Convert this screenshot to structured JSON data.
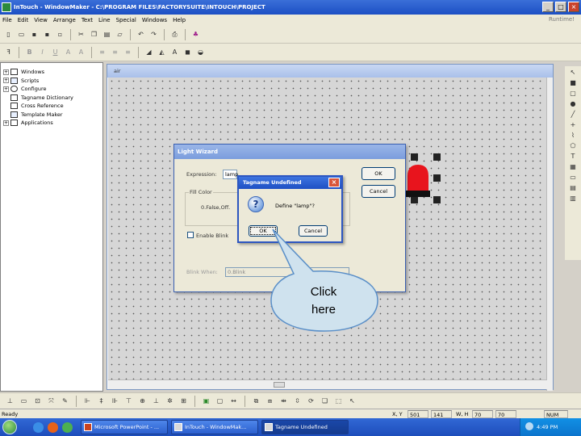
{
  "window": {
    "title": "InTouch - WindowMaker - C:\\PROGRAM FILES\\FACTORYSUITE\\INTOUCH\\PROJECT",
    "minimize_glyph": "_",
    "maximize_glyph": "□",
    "close_glyph": "×"
  },
  "menu": {
    "items": [
      "File",
      "Edit",
      "View",
      "Arrange",
      "Text",
      "Line",
      "Special",
      "Windows",
      "Help"
    ],
    "runtime_label": "Runtime!"
  },
  "tree": {
    "items": [
      {
        "label": "Windows",
        "expander": "+"
      },
      {
        "label": "Scripts",
        "expander": "+"
      },
      {
        "label": "Configure",
        "expander": "+"
      },
      {
        "label": "Tagname Dictionary",
        "expander": ""
      },
      {
        "label": "Cross Reference",
        "expander": ""
      },
      {
        "label": "Template Maker",
        "expander": ""
      },
      {
        "label": "Applications",
        "expander": "+"
      }
    ]
  },
  "canvas": {
    "title": "air"
  },
  "wizard": {
    "title": "Light Wizard",
    "expression_label": "Expression:",
    "expression_value": "lamp",
    "ok_label": "OK",
    "cancel_label": "Cancel",
    "fill_color_label": "Fill Color",
    "false_label": "0.False,Off.",
    "enable_blink_label": "Enable Blink",
    "blink_when_label": "Blink When:",
    "blink_when_value": "0.Blink"
  },
  "undefined_dialog": {
    "title": "Tagname Undefined",
    "message": "Define \"lamp\"?",
    "ok_label": "OK",
    "cancel_label": "Cancel",
    "close_glyph": "×",
    "question_glyph": "?"
  },
  "callout": {
    "line1": "Click",
    "line2": "here",
    "fill": "#cfe2ee",
    "stroke": "#5a8fc8"
  },
  "status": {
    "ready": "Ready",
    "xy_label": "X, Y",
    "x_value": "501",
    "y_value": "141",
    "wh_label": "W, H",
    "w_value": "70",
    "h_value": "70",
    "num": "NUM"
  },
  "taskbar": {
    "buttons": [
      "Microsoft PowerPoint - ...",
      "InTouch - WindowMak...",
      "Tagname Undefined"
    ],
    "clock": "4:49 PM"
  },
  "colors": {
    "light_red": "#e8141d",
    "light_base": "#111111",
    "canvas_bg": "#d6d6d6"
  }
}
